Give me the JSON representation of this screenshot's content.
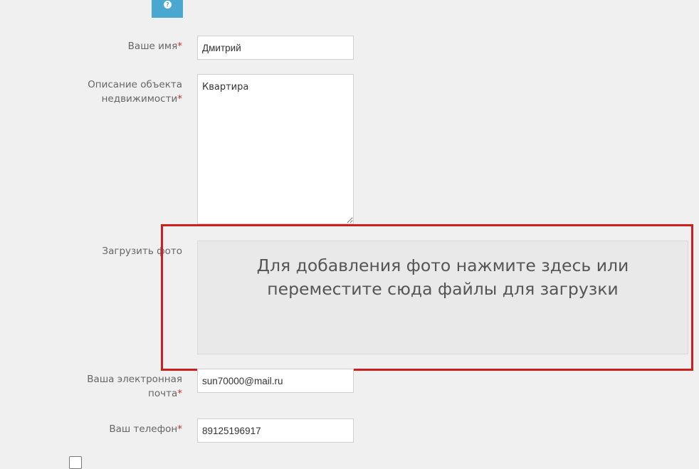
{
  "help": {
    "icon": "?"
  },
  "form": {
    "name": {
      "label": "Ваше имя",
      "required_mark": "*",
      "value": "Дмитрий"
    },
    "description": {
      "label_line1": "Описание объекта",
      "label_line2": "недвижимости",
      "required_mark": "*",
      "value": "Квартира"
    },
    "photo": {
      "label": "Загрузить фото",
      "dropzone_text": "Для добавления фото нажмите здесь или переместите сюда файлы для загрузки"
    },
    "email": {
      "label_line1": "Ваша электронная",
      "label_line2": "почта",
      "required_mark": "*",
      "value": "sun70000@mail.ru"
    },
    "phone": {
      "label": "Ваш телефон",
      "required_mark": "*",
      "value": "89125196917"
    }
  },
  "colors": {
    "background": "#f0f0f0",
    "accent": "#4aa8d0",
    "required": "#c9302c",
    "highlight": "#cc1f1f"
  }
}
